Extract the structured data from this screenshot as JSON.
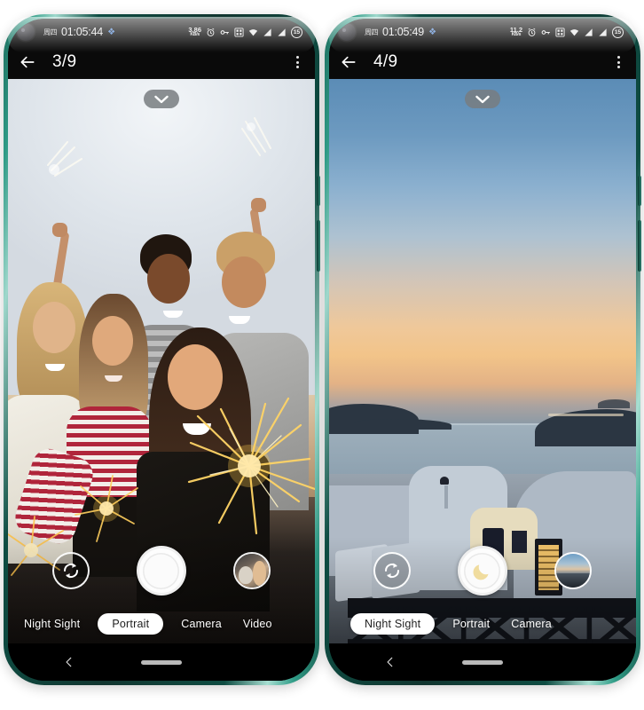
{
  "page": {
    "background": "#ffffff",
    "device_frame_color": "#11352f",
    "device_accent_color": "#2f9b86"
  },
  "phones": [
    {
      "id": "phone-left",
      "status_bar": {
        "cjk_prefix": "周四",
        "clock": "01:05:44",
        "network_speed_value": "3.86",
        "network_speed_unit": "KB/s",
        "icons": [
          "alarm-icon",
          "vpn-key-icon",
          "qr-scan-icon",
          "wifi-icon",
          "signal-icon",
          "signal-icon"
        ],
        "battery_level": "15"
      },
      "app_bar": {
        "back_icon": "arrow-left-icon",
        "page_counter": "3/9",
        "menu_icon": "kebab-menu-icon"
      },
      "viewfinder": {
        "collapse_icon": "chevron-down-icon",
        "scene": "group-selfie-sparklers",
        "scene_description": "Five friends taking a group selfie at dusk holding lit sparklers"
      },
      "controls": {
        "flip_camera_icon": "camera-flip-icon",
        "shutter_icon": "shutter-ring",
        "shutter_mode": "photo",
        "thumbnail": "woman-with-dog-thumbnail"
      },
      "modes": [
        {
          "label": "Night Sight",
          "active": false
        },
        {
          "label": "Portrait",
          "active": true
        },
        {
          "label": "Camera",
          "active": false
        },
        {
          "label": "Video",
          "active": false
        }
      ],
      "nav_bar": {
        "back_icon": "chevron-left-icon",
        "home_indicator": "home-pill"
      }
    },
    {
      "id": "phone-right",
      "status_bar": {
        "cjk_prefix": "周四",
        "clock": "01:05:49",
        "network_speed_value": "11.2",
        "network_speed_unit": "KB/s",
        "icons": [
          "alarm-icon",
          "vpn-key-icon",
          "qr-scan-icon",
          "wifi-icon",
          "signal-icon",
          "signal-icon"
        ],
        "battery_level": "15"
      },
      "app_bar": {
        "back_icon": "arrow-left-icon",
        "page_counter": "4/9",
        "menu_icon": "kebab-menu-icon"
      },
      "viewfinder": {
        "collapse_icon": "chevron-down-icon",
        "scene": "santorini-sunset",
        "scene_description": "Santorini caldera at dusk: orange horizon over calm sea with whitewashed buildings below"
      },
      "controls": {
        "flip_camera_icon": "camera-flip-icon",
        "shutter_icon": "moon-icon",
        "shutter_mode": "night",
        "thumbnail": "seascape-thumbnail"
      },
      "modes": [
        {
          "label": "Night Sight",
          "active": true
        },
        {
          "label": "Portrait",
          "active": false
        },
        {
          "label": "Camera",
          "active": false
        }
      ],
      "nav_bar": {
        "back_icon": "chevron-left-icon",
        "home_indicator": "home-pill"
      }
    }
  ]
}
